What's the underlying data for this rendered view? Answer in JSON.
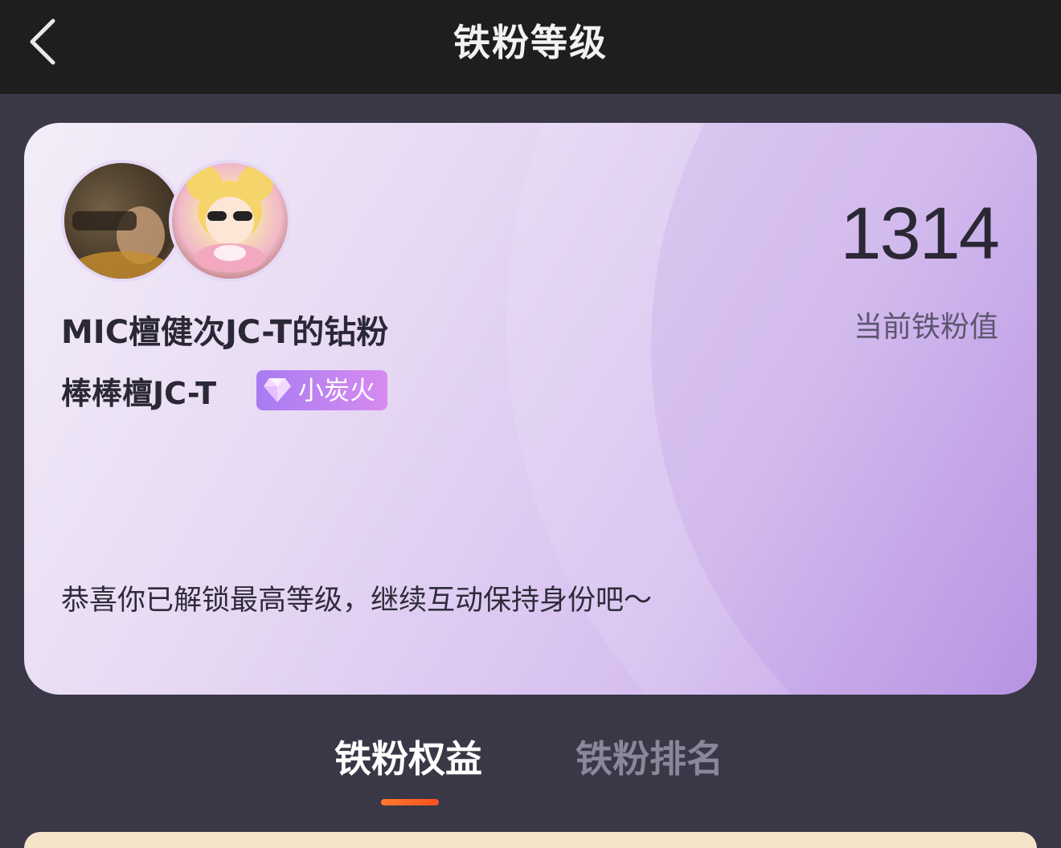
{
  "header": {
    "title": "铁粉等级",
    "back_icon": "chevron-left-icon"
  },
  "card": {
    "fan_title": "MIC檀健次JC-T的钻粉",
    "username": "棒棒檀JC-T",
    "badge_label": "小炭火",
    "badge_icon": "diamond-icon",
    "fan_value": "1314",
    "fan_value_label": "当前铁粉值",
    "congrats_text": "恭喜你已解锁最高等级，继续互动保持身份吧～",
    "colors": {
      "card_start": "#f3edf8",
      "card_end": "#b58fe2",
      "badge_start": "#a87cf2",
      "badge_end": "#d68bf0"
    }
  },
  "tabs": [
    {
      "label": "铁粉权益",
      "active": true
    },
    {
      "label": "铁粉排名",
      "active": false
    }
  ],
  "colors": {
    "background": "#3a3747",
    "topbar": "#1e1e1e",
    "tab_indicator": "#ff5a22"
  }
}
